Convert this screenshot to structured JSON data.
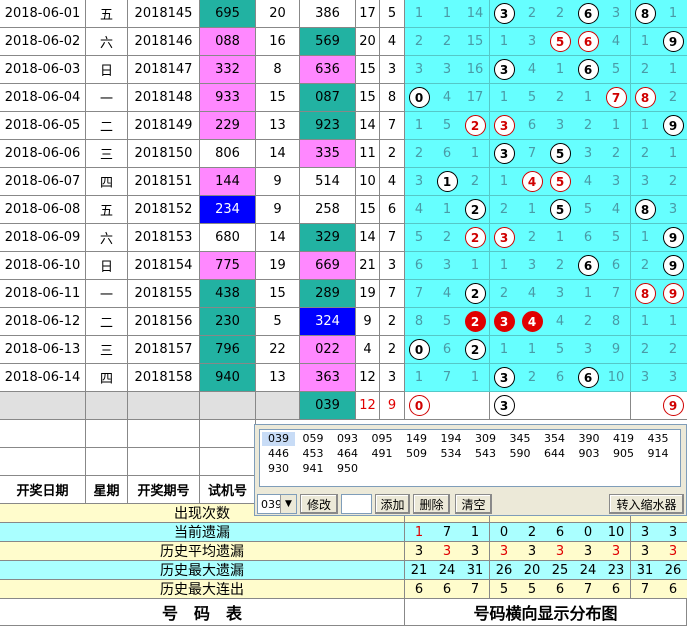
{
  "rows": [
    {
      "date": "2018-06-01",
      "week": "五",
      "issue": "2018145",
      "trial": "695",
      "trial_style": "teal",
      "s1": "20",
      "open": "386",
      "open_style": "white",
      "s2": "17",
      "s3": "5",
      "cells": [
        "1",
        "1",
        "14",
        "3",
        "2",
        "2",
        "6",
        "3",
        "8",
        "1"
      ],
      "marks": {
        "3": "blk",
        "6": "blk",
        "8": "blk"
      }
    },
    {
      "date": "2018-06-02",
      "week": "六",
      "issue": "2018146",
      "trial": "088",
      "trial_style": "pink",
      "s1": "16",
      "open": "569",
      "open_style": "teal",
      "s2": "20",
      "s3": "4",
      "cells": [
        "2",
        "2",
        "15",
        "1",
        "3",
        "5",
        "6",
        "4",
        "1",
        "9"
      ],
      "marks": {
        "5": "red",
        "6": "red",
        "9": "blk"
      }
    },
    {
      "date": "2018-06-03",
      "week": "日",
      "issue": "2018147",
      "trial": "332",
      "trial_style": "pink",
      "s1": "8",
      "open": "636",
      "open_style": "pink",
      "s2": "15",
      "s3": "3",
      "cells": [
        "3",
        "3",
        "16",
        "3",
        "4",
        "1",
        "6",
        "5",
        "2",
        "1"
      ],
      "marks": {
        "3": "blk",
        "6": "blk"
      }
    },
    {
      "date": "2018-06-04",
      "week": "一",
      "issue": "2018148",
      "trial": "933",
      "trial_style": "pink",
      "s1": "15",
      "open": "087",
      "open_style": "teal",
      "s2": "15",
      "s3": "8",
      "cells": [
        "0",
        "4",
        "17",
        "1",
        "5",
        "2",
        "1",
        "7",
        "8",
        "2"
      ],
      "marks": {
        "0": "blk",
        "7": "red",
        "8": "red"
      }
    },
    {
      "date": "2018-06-05",
      "week": "二",
      "issue": "2018149",
      "trial": "229",
      "trial_style": "pink",
      "s1": "13",
      "open": "923",
      "open_style": "teal",
      "s2": "14",
      "s3": "7",
      "cells": [
        "1",
        "5",
        "2",
        "3",
        "6",
        "3",
        "2",
        "1",
        "1",
        "9"
      ],
      "marks": {
        "2": "red",
        "3": "red",
        "9": "blk"
      }
    },
    {
      "date": "2018-06-06",
      "week": "三",
      "issue": "2018150",
      "trial": "806",
      "trial_style": "white",
      "s1": "14",
      "open": "335",
      "open_style": "pink",
      "s2": "11",
      "s3": "2",
      "cells": [
        "2",
        "6",
        "1",
        "3",
        "7",
        "5",
        "3",
        "2",
        "2",
        "1"
      ],
      "marks": {
        "3": "blk",
        "5": "blk"
      }
    },
    {
      "date": "2018-06-07",
      "week": "四",
      "issue": "2018151",
      "trial": "144",
      "trial_style": "pink",
      "s1": "9",
      "open": "514",
      "open_style": "white",
      "s2": "10",
      "s3": "4",
      "cells": [
        "3",
        "1",
        "2",
        "1",
        "4",
        "5",
        "4",
        "3",
        "3",
        "2"
      ],
      "marks": {
        "1": "blk",
        "4": "red",
        "5": "red"
      }
    },
    {
      "date": "2018-06-08",
      "week": "五",
      "issue": "2018152",
      "trial": "234",
      "trial_style": "blue",
      "s1": "9",
      "open": "258",
      "open_style": "white",
      "s2": "15",
      "s3": "6",
      "cells": [
        "4",
        "1",
        "2",
        "2",
        "1",
        "5",
        "5",
        "4",
        "8",
        "3"
      ],
      "marks": {
        "2": "blk",
        "5": "blk",
        "8": "blk"
      }
    },
    {
      "date": "2018-06-09",
      "week": "六",
      "issue": "2018153",
      "trial": "680",
      "trial_style": "white",
      "s1": "14",
      "open": "329",
      "open_style": "teal",
      "s2": "14",
      "s3": "7",
      "cells": [
        "5",
        "2",
        "2",
        "3",
        "2",
        "1",
        "6",
        "5",
        "1",
        "9"
      ],
      "marks": {
        "2": "red",
        "3": "red",
        "9": "blk"
      }
    },
    {
      "date": "2018-06-10",
      "week": "日",
      "issue": "2018154",
      "trial": "775",
      "trial_style": "pink",
      "s1": "19",
      "open": "669",
      "open_style": "pink",
      "s2": "21",
      "s3": "3",
      "cells": [
        "6",
        "3",
        "1",
        "1",
        "3",
        "2",
        "6",
        "6",
        "2",
        "9"
      ],
      "marks": {
        "6": "blk",
        "9": "blk"
      }
    },
    {
      "date": "2018-06-11",
      "week": "一",
      "issue": "2018155",
      "trial": "438",
      "trial_style": "teal",
      "s1": "15",
      "open": "289",
      "open_style": "teal",
      "s2": "19",
      "s3": "7",
      "cells": [
        "7",
        "4",
        "2",
        "2",
        "4",
        "3",
        "1",
        "7",
        "8",
        "9"
      ],
      "marks": {
        "2": "blk",
        "8": "red",
        "9": "red"
      }
    },
    {
      "date": "2018-06-12",
      "week": "二",
      "issue": "2018156",
      "trial": "230",
      "trial_style": "teal",
      "s1": "5",
      "open": "324",
      "open_style": "blue",
      "s2": "9",
      "s3": "2",
      "cells": [
        "8",
        "5",
        "2",
        "3",
        "4",
        "4",
        "2",
        "8",
        "1",
        "1"
      ],
      "marks": {
        "2": "fill",
        "3": "fill",
        "4": "fill"
      }
    },
    {
      "date": "2018-06-13",
      "week": "三",
      "issue": "2018157",
      "trial": "796",
      "trial_style": "teal",
      "s1": "22",
      "open": "022",
      "open_style": "pink",
      "s2": "4",
      "s3": "2",
      "cells": [
        "0",
        "6",
        "2",
        "1",
        "1",
        "5",
        "3",
        "9",
        "2",
        "2"
      ],
      "marks": {
        "0": "blk",
        "2": "blk"
      }
    },
    {
      "date": "2018-06-14",
      "week": "四",
      "issue": "2018158",
      "trial": "940",
      "trial_style": "teal",
      "s1": "13",
      "open": "363",
      "open_style": "pink",
      "s2": "12",
      "s3": "3",
      "cells": [
        "1",
        "7",
        "1",
        "3",
        "2",
        "6",
        "6",
        "10",
        "3",
        "3"
      ],
      "marks": {
        "3": "blk",
        "6": "blk"
      }
    }
  ],
  "predict_row": {
    "open": "039",
    "s2": "12",
    "s3": "9",
    "marks": {
      "0": "red",
      "3": "blk",
      "9": "red"
    }
  },
  "headers": {
    "date": "开奖日期",
    "week": "星期",
    "issue": "开奖期号",
    "trial": "试机号"
  },
  "number_panel": {
    "numbers": [
      "039",
      "059",
      "093",
      "095",
      "149",
      "194",
      "309",
      "345",
      "354",
      "390",
      "419",
      "435",
      "446",
      "453",
      "464",
      "491",
      "509",
      "534",
      "543",
      "590",
      "644",
      "903",
      "905",
      "914",
      "930",
      "941",
      "950"
    ],
    "selected": "039",
    "combo_value": "039",
    "buttons": {
      "modify": "修改",
      "add": "添加",
      "delete": "删除",
      "clear": "清空",
      "shrink": "转入缩水器"
    }
  },
  "stats": [
    {
      "label": "出现次数",
      "values": [
        "",
        "",
        "",
        "",
        "",
        "",
        "",
        "",
        "",
        ""
      ],
      "bg": "#fffccc"
    },
    {
      "label": "当前遗漏",
      "values": [
        "1",
        "7",
        "1",
        "0",
        "2",
        "6",
        "0",
        "10",
        "3",
        "3"
      ],
      "bg": "#aaffff",
      "first_red": true
    },
    {
      "label": "历史平均遗漏",
      "values": [
        "3",
        "3",
        "3",
        "3",
        "3",
        "3",
        "3",
        "3",
        "3",
        "3"
      ],
      "bg": "#fffccc",
      "alt_red": true
    },
    {
      "label": "历史最大遗漏",
      "values": [
        "21",
        "24",
        "31",
        "26",
        "20",
        "25",
        "24",
        "23",
        "31",
        "26"
      ],
      "bg": "#aaffff"
    },
    {
      "label": "历史最大连出",
      "values": [
        "6",
        "6",
        "7",
        "5",
        "5",
        "6",
        "7",
        "6",
        "7",
        "6"
      ],
      "bg": "#fffccc"
    }
  ],
  "footer": {
    "left": "号　码　表",
    "right": "号码横向显示分布图"
  },
  "colors": {
    "teal": "#22b2a2",
    "pink": "#ff88ff",
    "blue": "#0000ff",
    "cyan": "#66ffff",
    "red": "#e00000"
  }
}
